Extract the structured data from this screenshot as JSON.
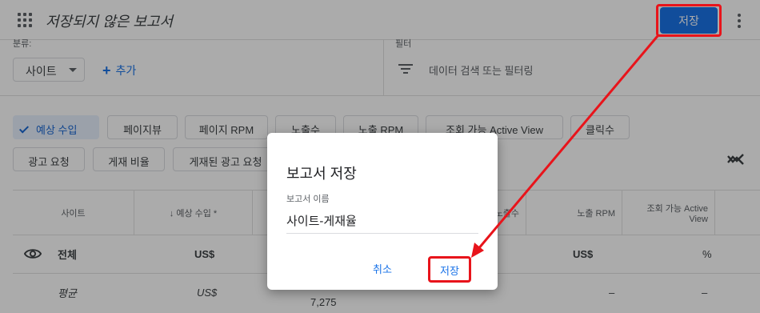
{
  "header": {
    "title": "저장되지 않은 보고서",
    "save_label": "저장"
  },
  "filters": {
    "dimension_label": "분류:",
    "dimension_value": "사이트",
    "add_label": "추가",
    "filter_label": "필터",
    "filter_placeholder": "데이터 검색 또는 필터링"
  },
  "metrics": [
    {
      "label": "예상 수입",
      "selected": true
    },
    {
      "label": "페이지뷰",
      "selected": false
    },
    {
      "label": "페이지 RPM",
      "selected": false
    },
    {
      "label": "노출수",
      "selected": false
    },
    {
      "label": "노출 RPM",
      "selected": false
    },
    {
      "label": "조회 가능 Active View",
      "selected": false
    },
    {
      "label": "클릭수",
      "selected": false
    },
    {
      "label": "광고 요청",
      "selected": false
    },
    {
      "label": "게재 비율",
      "selected": false
    },
    {
      "label": "게재된 광고 요청",
      "selected": false
    }
  ],
  "table": {
    "headers": {
      "site": "사이트",
      "revenue": "↓ 예상 수입 *",
      "impressions": "노출수",
      "impression_rpm": "노출 RPM",
      "active_view_1": "조회 가능 Active",
      "active_view_2": "View"
    },
    "total": {
      "label": "전체",
      "revenue": "US$",
      "impression_rpm": "US$",
      "active_view": "%"
    },
    "average": {
      "label": "평균",
      "revenue": "US$",
      "partial": "7,275",
      "impression_rpm": "–",
      "active_view": "–"
    }
  },
  "dialog": {
    "title": "보고서 저장",
    "name_label": "보고서 이름",
    "name_value": "사이트-게재율",
    "cancel_label": "취소",
    "save_label": "저장"
  },
  "colors": {
    "accent": "#1a73e8",
    "annotation": "#e8141b"
  }
}
